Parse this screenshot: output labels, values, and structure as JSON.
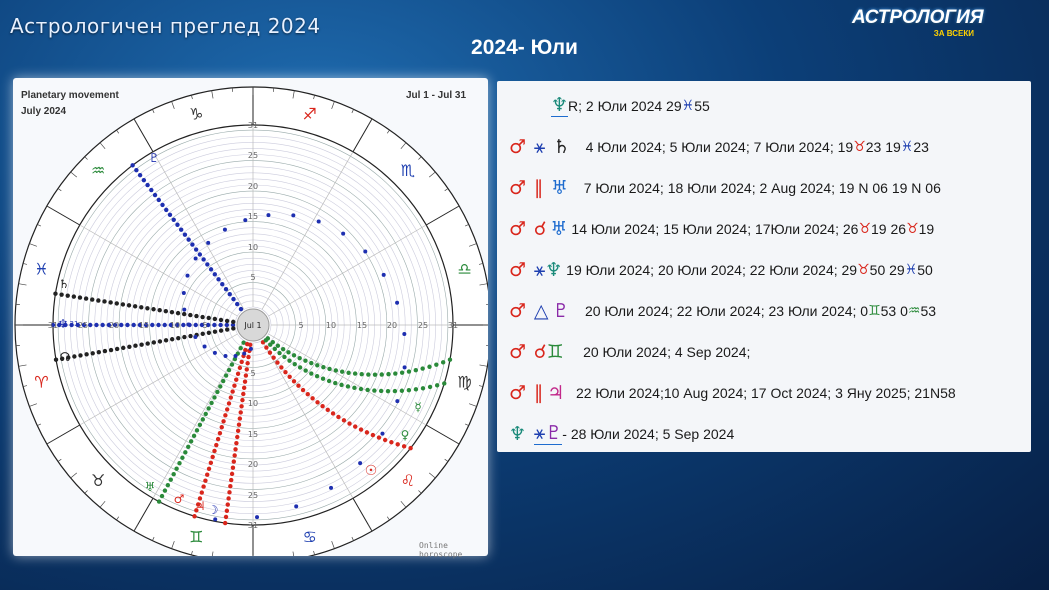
{
  "header": {
    "slide_title": "Астрологичен преглед 2024",
    "logo_main": "АСТРОЛОГИЯ",
    "logo_sub": "ЗА ВСЕКИ",
    "month_heading": "2024- Юли"
  },
  "chart": {
    "title_line1": "Planetary movement",
    "title_line2": "July 2024",
    "range": "Jul 1 - Jul 31",
    "center_label": "Jul 1",
    "watermark": "Online horoscope",
    "ring_labels": [
      "31",
      "25",
      "20",
      "15",
      "10",
      "5"
    ],
    "zodiac_signs": [
      "♈",
      "♉",
      "♊",
      "♋",
      "♌",
      "♍",
      "♎",
      "♏",
      "♐",
      "♑",
      "♒",
      "♓"
    ],
    "zodiac_colors": [
      "#d9261c",
      "#333333",
      "#2a8a3a",
      "#1e3fb0",
      "#d9261c",
      "#333333",
      "#2a8a3a",
      "#1e3fb0",
      "#d9261c",
      "#333333",
      "#2a8a3a",
      "#1e3fb0"
    ],
    "planet_labels": {
      "neptune": "♆",
      "neptune_day": "31",
      "saturn": "♄",
      "node": "☊",
      "pluto": "♇",
      "uranus": "♅",
      "mars": "♂",
      "jupiter": "♃",
      "moon": "☽",
      "sun": "☉",
      "venus": "♀",
      "mercury": "☿"
    }
  },
  "aspects": [
    {
      "text": "R;   2 Юли 2024  29 ",
      "tail": " 55"
    },
    {
      "text": "4 Юли 2024;  5 Юли 2024; 7 Юли 2024;       19",
      "mid1": "23  19",
      "tail": "23"
    },
    {
      "text": "7 Юли 2024;  18 Юли 2024; 2 Aug 2024;      19 N 06  19 N 06"
    },
    {
      "text": "14 Юли 2024; 15 Юли 2024; 17Юли 2024;     26",
      "mid1": "19   26",
      "tail": "19"
    },
    {
      "text": "19 Юли 2024; 20 Юли 2024; 22 Юли 2024;    29",
      "mid1": "50  29",
      "tail": "50"
    },
    {
      "text": "20 Юли 2024;  22 Юли 2024; 23 Юли 2024;     0",
      "mid1": "53    0",
      "tail": "53"
    },
    {
      "text": "20 Юли 2024;    4 Sep 2024;"
    },
    {
      "text": "22 Юли 2024;10 Aug 2024; 17 Oct 2024; 3 Яну 2025; 21N58"
    },
    {
      "text": "- 28 Юли 2024;     5 Sep 2024"
    }
  ],
  "symbols": {
    "neptune": "♆",
    "mars": "♂",
    "sextile": "⚹",
    "saturn": "♄",
    "parallel": "∥",
    "uranus": "♅",
    "conjunction": "☌",
    "trine": "△",
    "pluto": "♇",
    "gemini": "♊",
    "jupiter": "♃",
    "taurus": "♉",
    "pisces": "♓",
    "aquarius": "♒"
  },
  "colors": {
    "mars_red": "#d9261c",
    "aspect_blue": "#1e3fb0",
    "neptune_teal": "#1a8a7a",
    "pluto_purple": "#8a2aa8",
    "green_track": "#2a8a3a",
    "dark_track": "#222222",
    "blue_track": "#1e2fb0"
  }
}
